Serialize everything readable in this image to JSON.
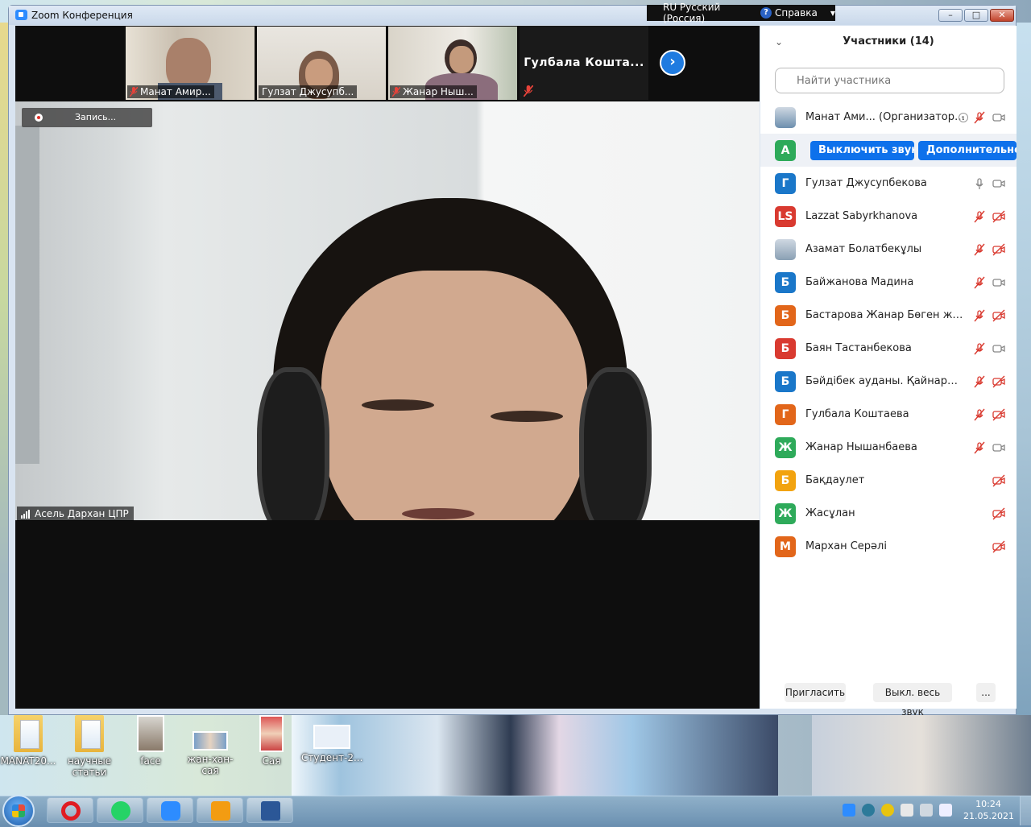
{
  "window": {
    "title": "Zoom Конференция",
    "language": "RU Русский (Россия)",
    "help": "Справка"
  },
  "video": {
    "thumbnails": [
      {
        "name": "Манат Амир..."
      },
      {
        "name": "Гулзат Джусупб..."
      },
      {
        "name": "Жанар Ныш..."
      }
    ],
    "name_tile": "Гулбала  Кошта...",
    "recording_label": "Запись...",
    "active_speaker": "Асель Дархан  ЦПР"
  },
  "participants": {
    "header": "Участники (14)",
    "search_placeholder": "Найти участника",
    "hover_actions": {
      "mute": "Выключить звук",
      "more": "Дополнительно"
    },
    "list": [
      {
        "initials": "",
        "name": "Манат Ами... (Организатор, я)",
        "color": "#6d8fae",
        "photo": true,
        "mic": "muted",
        "video": "on"
      },
      {
        "initials": "А",
        "name": "",
        "color": "#2eaa5a",
        "mic": "",
        "video": ""
      },
      {
        "initials": "Г",
        "name": "Гулзат Джусупбекова",
        "color": "#1a77c9",
        "mic": "on",
        "video": "on"
      },
      {
        "initials": "LS",
        "name": "Lazzat Sabyrkhanova",
        "color": "#d93a30",
        "mic": "muted",
        "video": "off"
      },
      {
        "initials": "",
        "name": "Азамат Болатбекұлы",
        "color": "#8aa0b4",
        "photo": true,
        "mic": "muted",
        "video": "off"
      },
      {
        "initials": "Б",
        "name": "Байжанова Мадина",
        "color": "#1a77c9",
        "mic": "muted",
        "video": "on"
      },
      {
        "initials": "Б",
        "name": "Бастарова Жанар Бөген жом",
        "color": "#e2661a",
        "mic": "muted",
        "video": "off"
      },
      {
        "initials": "Б",
        "name": "Баян Тастанбекова",
        "color": "#d93a30",
        "mic": "muted",
        "video": "on"
      },
      {
        "initials": "Б",
        "name": "Бәйдібек ауданы. ҚайнарЖОМ. ...",
        "color": "#1a77c9",
        "mic": "muted",
        "video": "off"
      },
      {
        "initials": "Г",
        "name": "Гулбала Коштаева",
        "color": "#e2661a",
        "mic": "muted",
        "video": "off"
      },
      {
        "initials": "Ж",
        "name": "Жанар Нышанбаева",
        "color": "#2eaa5a",
        "mic": "muted",
        "video": "on"
      },
      {
        "initials": "Б",
        "name": "Бақдаулет",
        "color": "#f2a30f",
        "mic": "",
        "video": "off"
      },
      {
        "initials": "Ж",
        "name": "Жасұлан",
        "color": "#2eaa5a",
        "mic": "",
        "video": "off"
      },
      {
        "initials": "М",
        "name": "Мархан Серәлі",
        "color": "#e2661a",
        "mic": "",
        "video": "off"
      }
    ],
    "footer": {
      "invite": "Пригласить",
      "mute_all": "Выкл. весь звук",
      "more": "..."
    }
  },
  "desktop_icons": [
    {
      "label": "MANAT20..."
    },
    {
      "label": "научные статьи"
    },
    {
      "label": "face"
    },
    {
      "label": "жан-хан-сая"
    },
    {
      "label": "Сая"
    },
    {
      "label": "Студент-2..."
    }
  ],
  "taskbar": {
    "apps": [
      "opera-icon",
      "whatsapp-icon",
      "zoom-icon",
      "media-player-icon",
      "word-icon"
    ],
    "time": "10:24",
    "date": "21.05.2021"
  },
  "colors": {
    "accent": "#0e71eb",
    "muted_red": "#d93a30"
  }
}
